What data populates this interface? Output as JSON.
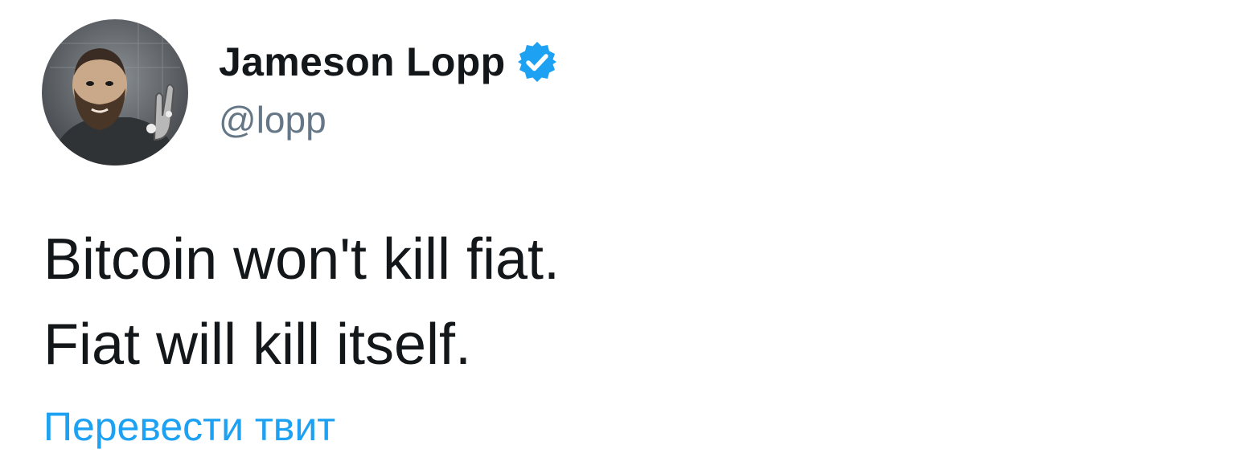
{
  "author": {
    "display_name": "Jameson Lopp",
    "handle": "@lopp",
    "verified_icon": "verified-badge-icon",
    "avatar_icon": "avatar-illustration"
  },
  "tweet": {
    "lines": [
      "Bitcoin won't kill fiat.",
      "Fiat will kill itself."
    ],
    "translate_label": "Перевести твит"
  },
  "colors": {
    "name": "#14171a",
    "handle": "#657786",
    "text": "#14171a",
    "link": "#1da1f2",
    "verified": "#1da1f2"
  }
}
